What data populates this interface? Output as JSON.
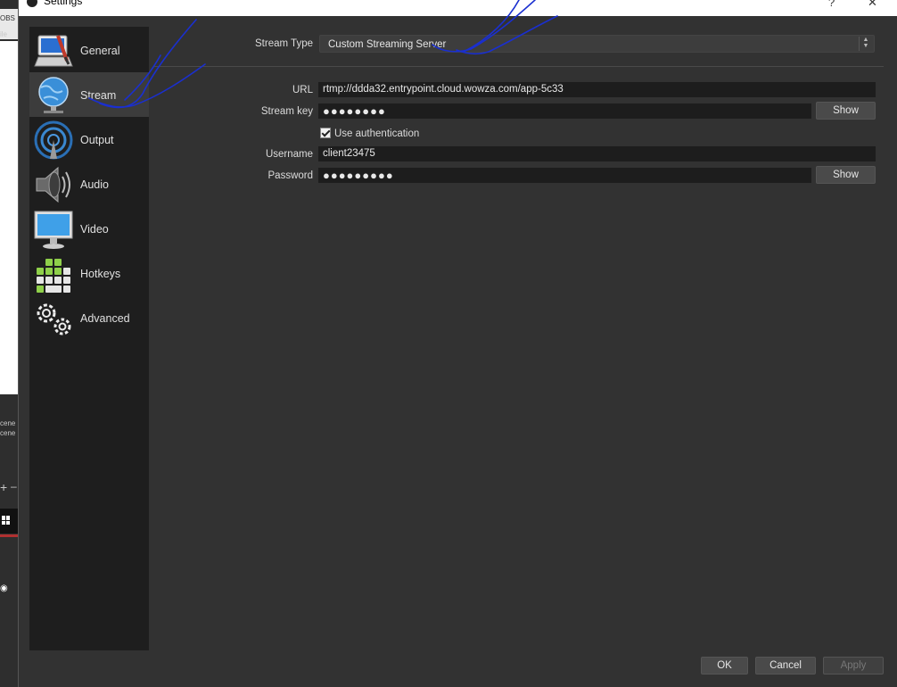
{
  "background_app": {
    "snippets": [
      "OBS",
      "ile",
      "cene",
      "cene 2",
      "+",
      "–"
    ]
  },
  "window": {
    "title": "Settings",
    "close_glyph": "✕",
    "min_glyph": "—"
  },
  "sidebar": {
    "items": [
      {
        "label": "General",
        "icon": "general-icon"
      },
      {
        "label": "Stream",
        "icon": "globe-icon"
      },
      {
        "label": "Output",
        "icon": "broadcast-icon"
      },
      {
        "label": "Audio",
        "icon": "speaker-icon"
      },
      {
        "label": "Video",
        "icon": "monitor-icon"
      },
      {
        "label": "Hotkeys",
        "icon": "keyboard-icon"
      },
      {
        "label": "Advanced",
        "icon": "gears-icon"
      }
    ],
    "active_index": 1
  },
  "stream": {
    "stream_type_label": "Stream Type",
    "stream_type_value": "Custom Streaming Server",
    "url_label": "URL",
    "url_value": "rtmp://ddda32.entrypoint.cloud.wowza.com/app-5c33",
    "stream_key_label": "Stream key",
    "stream_key_value": "●●●●●●●●",
    "show_key_label": "Show",
    "use_auth_label": "Use authentication",
    "use_auth_checked": true,
    "username_label": "Username",
    "username_value": "client23475",
    "password_label": "Password",
    "password_value": "●●●●●●●●●",
    "show_password_label": "Show"
  },
  "footer": {
    "ok_label": "OK",
    "cancel_label": "Cancel",
    "apply_label": "Apply"
  },
  "colors": {
    "window_bg": "#323232",
    "sidebar_bg": "#1e1e1e",
    "active_item_bg": "#3c3c3c",
    "field_bg": "#1d1d1d",
    "annotation_ink": "#1a2fd0"
  }
}
